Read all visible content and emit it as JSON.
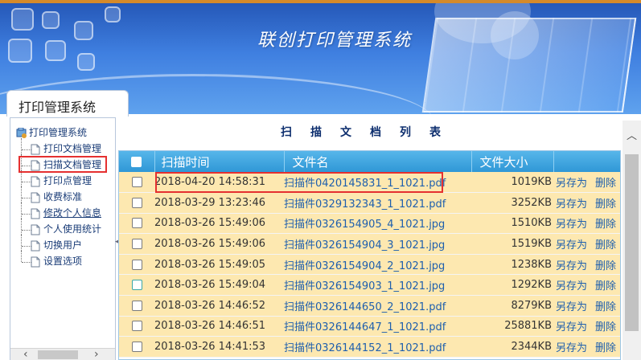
{
  "header": {
    "system_title": "联创打印管理系统"
  },
  "sidebar": {
    "tab_label": "打印管理系统",
    "root_label": "打印管理系统",
    "items": [
      {
        "label": "打印文档管理"
      },
      {
        "label": "扫描文档管理"
      },
      {
        "label": "打印点管理"
      },
      {
        "label": "收费标准"
      },
      {
        "label": "修改个人信息"
      },
      {
        "label": "个人使用统计"
      },
      {
        "label": "切换用户"
      },
      {
        "label": "设置选项"
      }
    ],
    "selected_index": 1
  },
  "main": {
    "list_title": "扫描文档列表",
    "columns": {
      "scan_time": "扫描时间",
      "file_name": "文件名",
      "file_size": "文件大小"
    },
    "rows": [
      {
        "time": "2018-04-20 14:58:31",
        "file": "扫描件0420145831_1_1021.pdf",
        "size": "1019KB",
        "save_as": "另存为",
        "delete": "删除"
      },
      {
        "time": "2018-03-29 13:23:46",
        "file": "扫描件0329132343_1_1021.pdf",
        "size": "3252KB",
        "save_as": "另存为",
        "delete": "删除"
      },
      {
        "time": "2018-03-26 15:49:06",
        "file": "扫描件0326154905_4_1021.jpg",
        "size": "1510KB",
        "save_as": "另存为",
        "delete": "删除"
      },
      {
        "time": "2018-03-26 15:49:06",
        "file": "扫描件0326154904_3_1021.jpg",
        "size": "1519KB",
        "save_as": "另存为",
        "delete": "删除"
      },
      {
        "time": "2018-03-26 15:49:05",
        "file": "扫描件0326154904_2_1021.jpg",
        "size": "1238KB",
        "save_as": "另存为",
        "delete": "删除"
      },
      {
        "time": "2018-03-26 15:49:04",
        "file": "扫描件0326154903_1_1021.jpg",
        "size": "1292KB",
        "save_as": "另存为",
        "delete": "删除"
      },
      {
        "time": "2018-03-26 14:46:52",
        "file": "扫描件0326144650_2_1021.pdf",
        "size": "8279KB",
        "save_as": "另存为",
        "delete": "删除"
      },
      {
        "time": "2018-03-26 14:46:51",
        "file": "扫描件0326144647_1_1021.pdf",
        "size": "25881KB",
        "save_as": "另存为",
        "delete": "删除"
      },
      {
        "time": "2018-03-26 14:41:53",
        "file": "扫描件0326144152_1_1021.pdf",
        "size": "2344KB",
        "save_as": "另存为",
        "delete": "删除"
      }
    ],
    "highlighted_row": 0
  },
  "colors": {
    "header_blue": "#2f97d6",
    "row_bg": "#fde8b0",
    "link": "#1e5fae",
    "highlight_red": "#e53030"
  },
  "icons": [
    "tree-root-icon",
    "document-icon",
    "checkbox",
    "scroll-up-arrow",
    "scroll-left-arrow",
    "scroll-right-arrow"
  ]
}
